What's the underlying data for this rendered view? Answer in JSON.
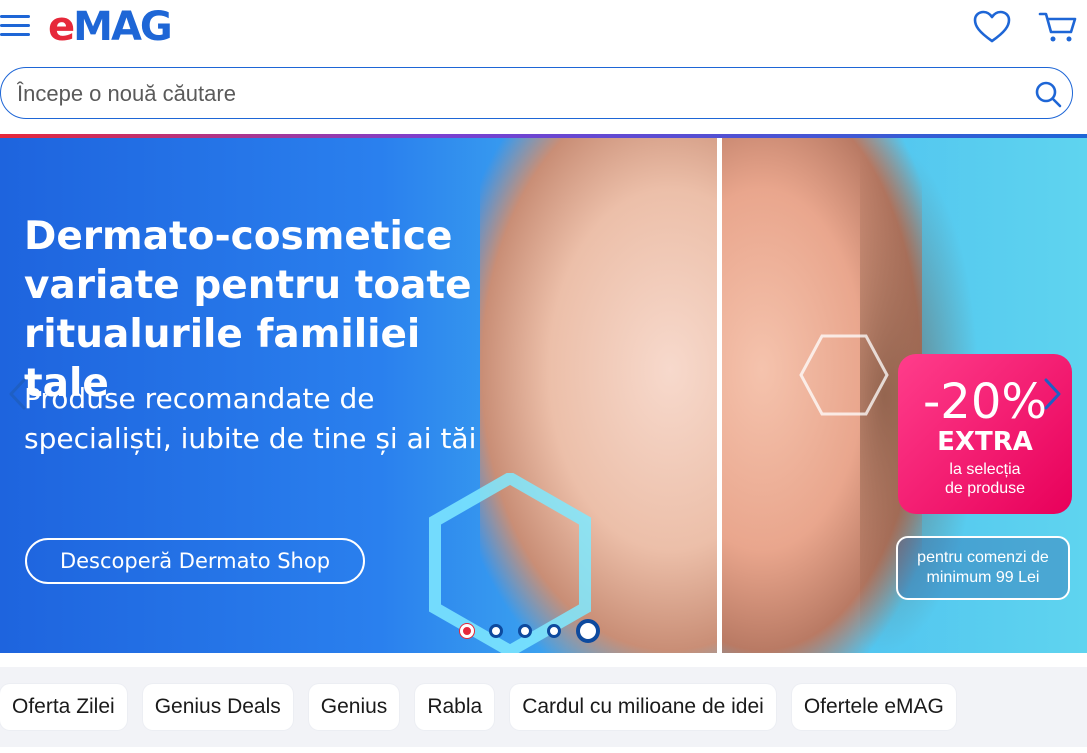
{
  "header": {
    "logo_e": "e",
    "logo_rest": "MAG",
    "icons": {
      "menu": "hamburger-menu-icon",
      "favorites": "heart-icon",
      "cart": "cart-icon"
    },
    "colors": {
      "brand_blue": "#1e66d6",
      "brand_red": "#e6283a"
    }
  },
  "search": {
    "placeholder": "Începe o nouă căutare",
    "value": "",
    "icon": "search-icon"
  },
  "banner": {
    "headline_lines": [
      "Dermato-cosmetice",
      "variate pentru toate",
      "ritualurile familiei tale"
    ],
    "subline_lines": [
      "Produse recomandate de",
      "specialiști, iubite de tine și ai tăi"
    ],
    "cta_label": "Descoperă Dermato Shop",
    "promo": {
      "percent": "-20%",
      "extra": "EXTRA",
      "selection_lines": [
        "la selecția",
        "de produse"
      ]
    },
    "minimum_lines": [
      "pentru comenzi de",
      "minimum 99 Lei"
    ],
    "slide_count": 5,
    "active_slide": 1
  },
  "quick_links": [
    {
      "label": "Oferta Zilei"
    },
    {
      "label": "Genius Deals"
    },
    {
      "label": "Genius"
    },
    {
      "label": "Rabla"
    },
    {
      "label": "Cardul cu milioane de idei"
    },
    {
      "label": "Ofertele eMAG"
    }
  ]
}
